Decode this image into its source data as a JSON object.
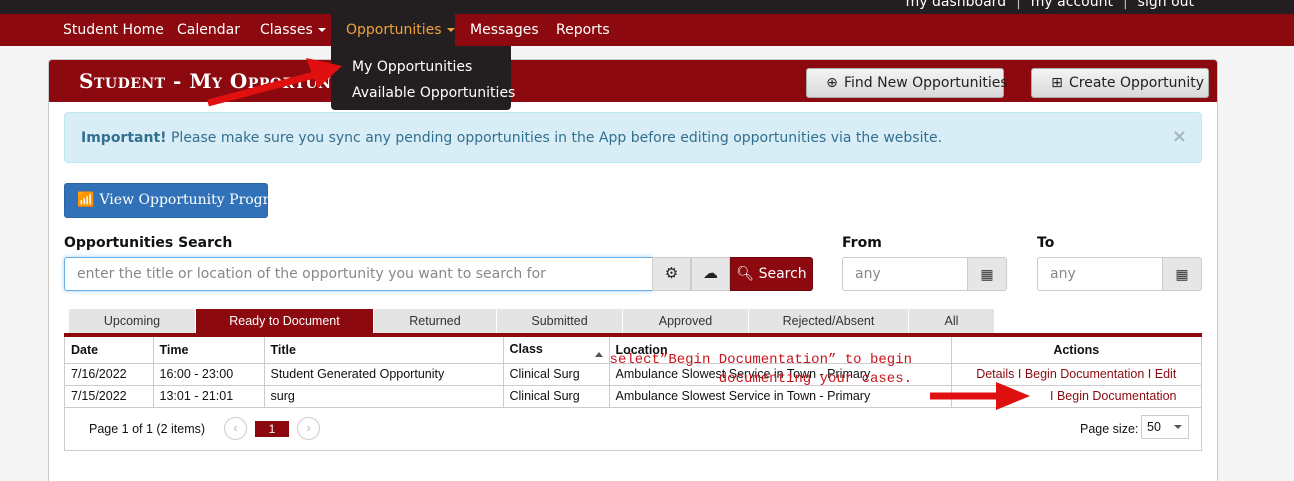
{
  "utility": {
    "dashboard": "my dashboard",
    "account": "my account",
    "signout": "sign out",
    "separator": "|"
  },
  "nav": {
    "items": [
      "Student Home",
      "Calendar",
      "Classes",
      "Opportunities",
      "Messages",
      "Reports"
    ],
    "active": "Opportunities",
    "dropdown": [
      "My Opportunities",
      "Available Opportunities"
    ]
  },
  "panel": {
    "title": "Student - My Opportunities",
    "find_btn": "Find New Opportunities",
    "create_btn": "Create Opportunity"
  },
  "alert": {
    "strong": "Important!",
    "text": " Please make sure you sync any pending opportunities in the App before editing opportunities via the website.",
    "close": "×"
  },
  "progress_btn": "View Opportunity Progress",
  "search": {
    "label": "Opportunities Search",
    "placeholder": "enter the title or location of the opportunity you want to search for",
    "button": "Search"
  },
  "dates": {
    "from_label": "From",
    "to_label": "To",
    "from_value": "any",
    "to_value": "any"
  },
  "tabs": [
    "Upcoming",
    "Ready to Document",
    "Returned",
    "Submitted",
    "Approved",
    "Rejected/Absent",
    "All"
  ],
  "active_tab": "Ready to Document",
  "table": {
    "headers": [
      "Date",
      "Time",
      "Title",
      "Class",
      "Location",
      "Actions"
    ],
    "rows": [
      {
        "date": "7/16/2022",
        "time": "16:00 - 23:00",
        "title": "Student Generated Opportunity",
        "class": "Clinical Surg",
        "location": "Ambulance Slowest Service in Town - Primary",
        "actions": "Details I Begin Documentation I Edit"
      },
      {
        "date": "7/15/2022",
        "time": "13:01 - 21:01",
        "title": "surg",
        "class": "Clinical Surg",
        "location": "Ambulance Slowest Service in Town - Primary",
        "actions": "I Begin Documentation"
      }
    ]
  },
  "pager": {
    "info": "Page 1 of 1 (2 items)",
    "current": "1",
    "size_label": "Page size:",
    "size_value": "50"
  },
  "annotation": "select”Begin Documentation” to begin\ndocumenting your cases.",
  "colors": {
    "brand": "#8c0a0f",
    "active_nav_text": "#f0a23c",
    "annotation": "#c8141b",
    "info_bg": "#d9edf7"
  }
}
